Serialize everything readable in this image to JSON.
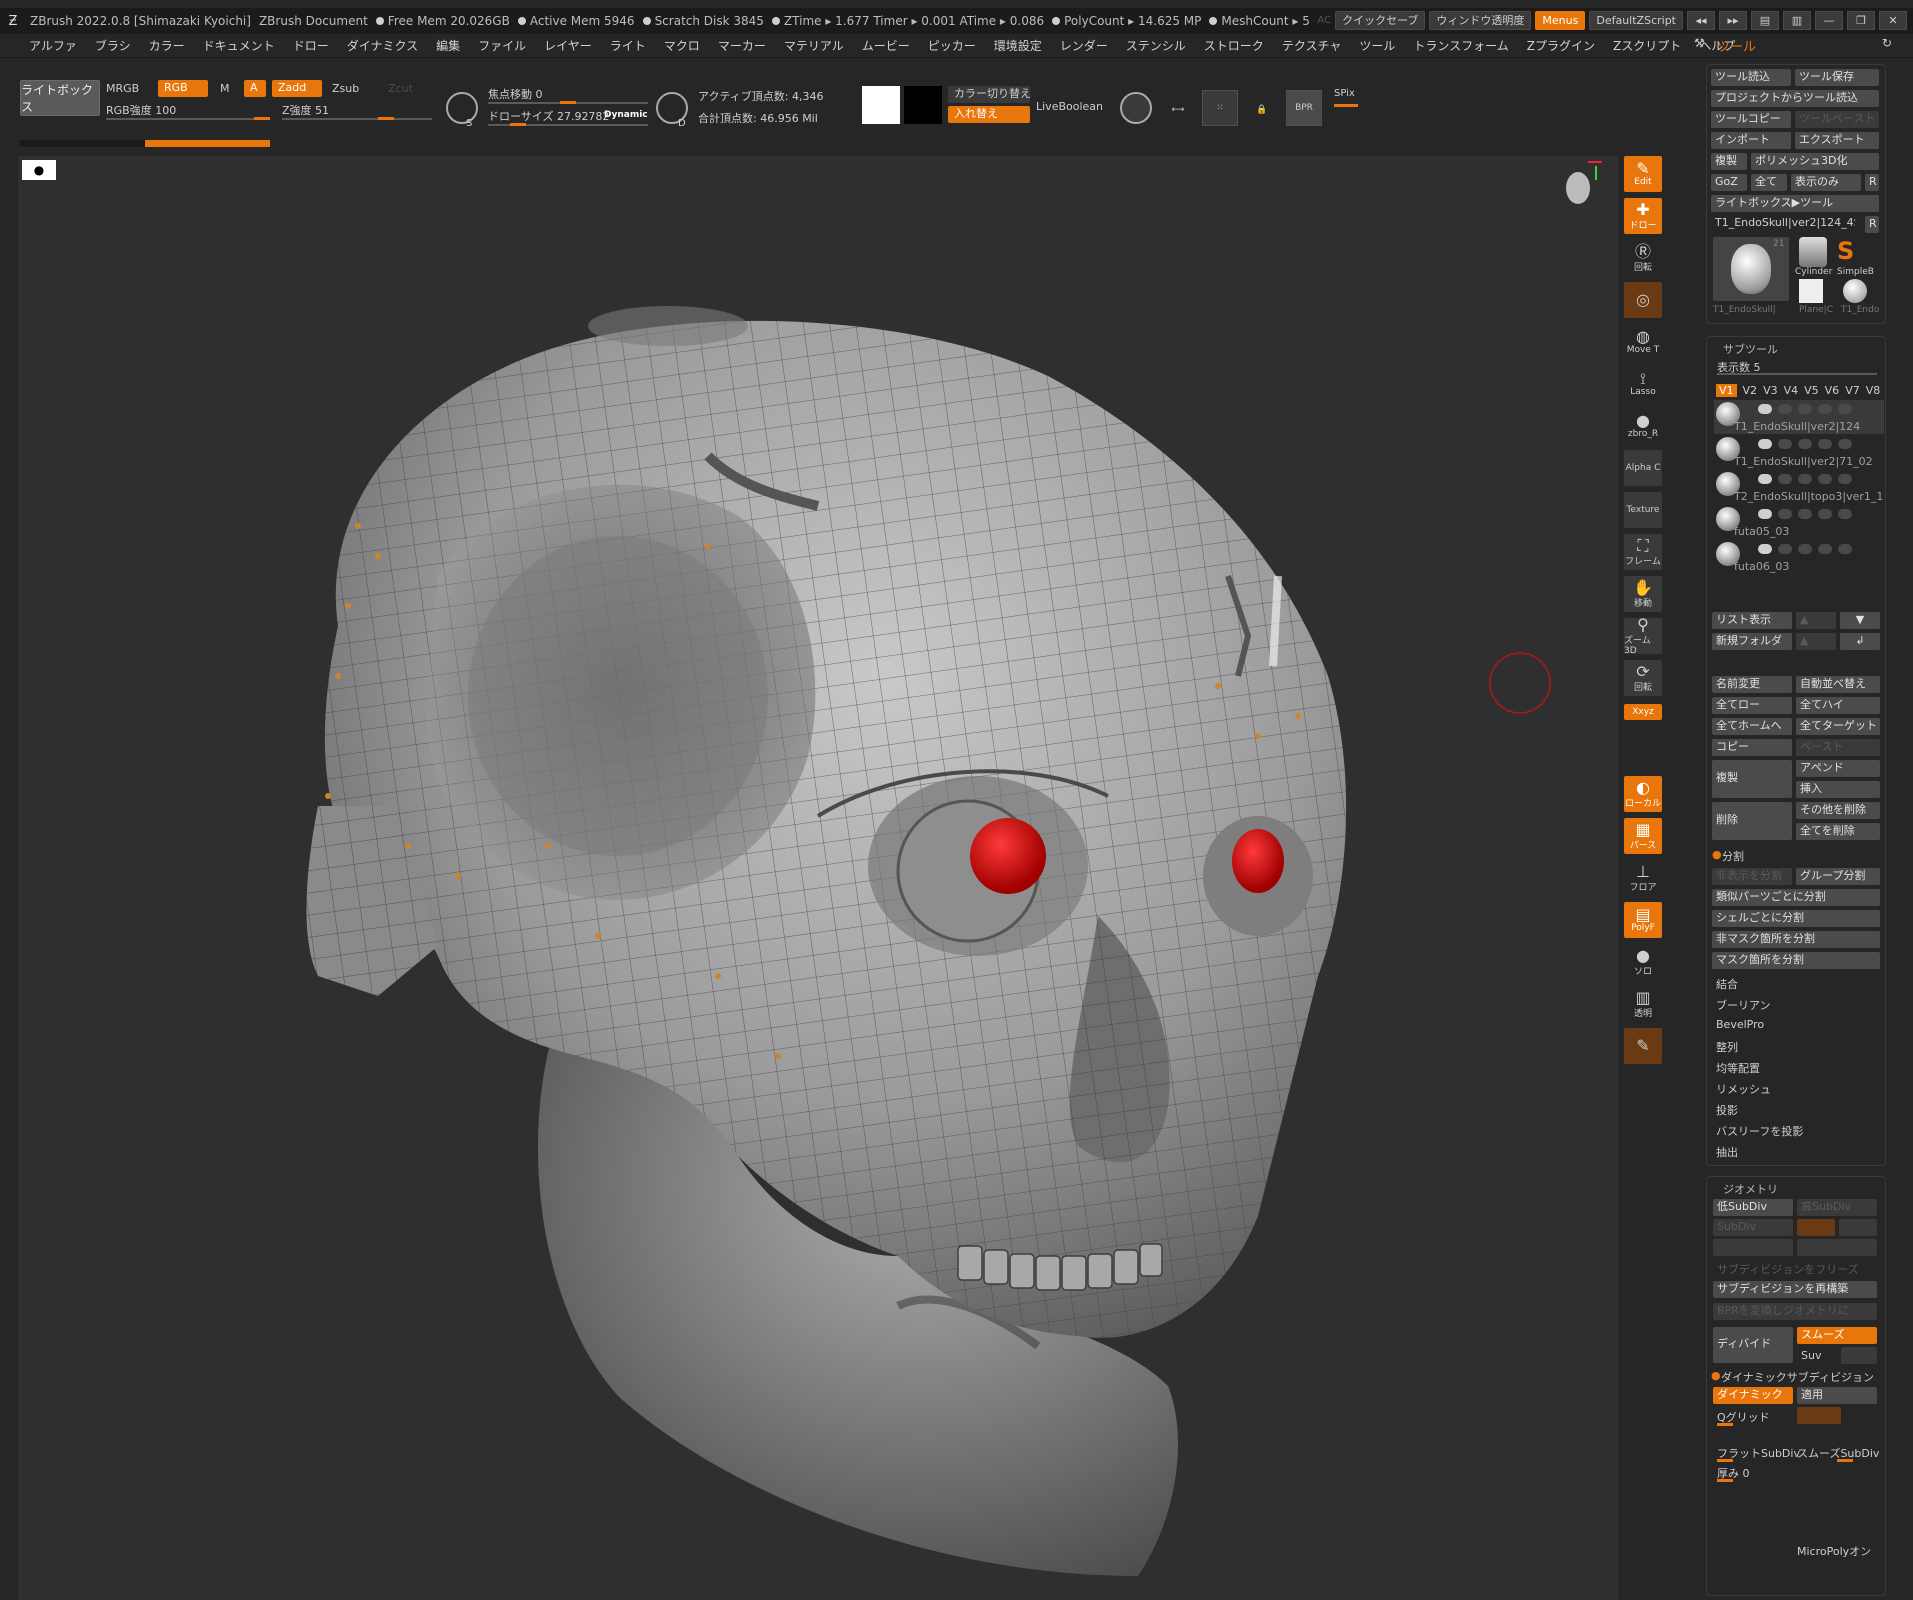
{
  "titlebar": {
    "app": "ZBrush 2022.0.8 [Shimazaki Kyoichi]",
    "doc": "ZBrush Document",
    "stats": [
      "Free Mem 20.026GB",
      "Active Mem 5946",
      "Scratch Disk 3845",
      "ZTime ▸ 1.677 Timer ▸ 0.001 ATime ▸ 0.086",
      "PolyCount ▸ 14.625 MP",
      "MeshCount ▸ 5"
    ],
    "right_ac": "AC",
    "quicksave": "クイックセーブ",
    "transparency": "ウィンドウ透明度",
    "menus": "Menus",
    "script": "DefaultZScript"
  },
  "menu": {
    "items": [
      "アルファ",
      "ブラシ",
      "カラー",
      "ドキュメント",
      "ドロー",
      "ダイナミクス",
      "編集",
      "ファイル",
      "レイヤー",
      "ライト",
      "マクロ",
      "マーカー",
      "マテリアル",
      "ムービー",
      "ピッカー",
      "環境設定",
      "レンダー",
      "ステンシル",
      "ストローク",
      "テクスチャ",
      "ツール",
      "トランスフォーム",
      "Zプラグイン",
      "Zスクリプト",
      "ヘルプ"
    ],
    "tool_label": "ツール"
  },
  "shelf": {
    "lightbox": "ライトボックス",
    "mrgb": "MRGB",
    "rgb": "RGB",
    "m": "M",
    "a": "A",
    "zadd": "Zadd",
    "zsub": "Zsub",
    "zcut": "Zcut",
    "rgb_intensity": "RGB強度 100",
    "z_intensity": "Z強度 51",
    "focal_shift": "焦点移動 0",
    "draw_size": "ドローサイズ 27.92782",
    "dynamic": "Dynamic",
    "active_points": "アクティブ頂点数: 4,346",
    "total_points": "合計頂点数: 46.956 Mil",
    "color_switch": "カラー切り替え",
    "swap": "入れ替え",
    "liveboolean": "LiveBoolean",
    "spix": "SPix",
    "bpr": "BPR",
    "s": "S",
    "d": "D"
  },
  "progress": {
    "value": 0.5
  },
  "rightstrip": {
    "edit": "Edit",
    "draw": "ドロー",
    "rotate": "回転",
    "move": "Move T",
    "lasso": "Lasso",
    "zbro": "zbro_R",
    "alpha": "Alpha C",
    "texture": "Texture",
    "frame": "フレーム",
    "pan": "移動",
    "zoom": "ズーム3D",
    "rot": "回転",
    "xyz": "Xxyz",
    "local": "ローカル",
    "persp": "パース",
    "floor": "フロア",
    "polyf": "PolyF",
    "solo": "ソロ",
    "transp": "透明"
  },
  "tool_panel": {
    "load": "ツール読込",
    "save": "ツール保存",
    "load_project": "プロジェクトからツール読込",
    "copy": "ツールコピー",
    "paste": "ツールペースト",
    "import": "インポート",
    "export": "エクスポート",
    "clone": "複製",
    "polymesh": "ポリメッシュ3D化",
    "goz": "GoZ",
    "all": "全て",
    "visible": "表示のみ",
    "r": "R",
    "lightbox_tool": "ライトボックス▶ツール",
    "current_tool": "T1_EndoSkull|ver2|124_4S",
    "count": "21",
    "thumbs": [
      "T1_EndoSkull|",
      "Cylinder",
      "SimpleB",
      "Plane|C",
      "T1_Endo"
    ]
  },
  "subtool": {
    "header": "サブツール",
    "visible_count": "表示数 5",
    "vtabs": [
      "V1",
      "V2",
      "V3",
      "V4",
      "V5",
      "V6",
      "V7",
      "V8"
    ],
    "items": [
      "T1_EndoSkull|ver2|124",
      "T1_EndoSkull|ver2|71_02",
      "T2_EndoSkull|topo3|ver1_1",
      "futa05_03",
      "futa06_03"
    ],
    "list_view": "リスト表示",
    "new_folder": "新規フォルダ",
    "rename": "名前変更",
    "autoreorder": "自動並べ替え",
    "all_low": "全てロー",
    "all_high": "全てハイ",
    "all_home": "全てホームへ",
    "all_target": "全てターゲット",
    "copy": "コピー",
    "paste": "ペースト",
    "duplicate": "複製",
    "append": "アペンド",
    "insert": "挿入",
    "delete": "削除",
    "delete_other": "その他を削除",
    "delete_all": "全てを削除",
    "split_header": "分割",
    "split_hidden": "非表示を分割",
    "group_split": "グループ分割",
    "similar": "類似パーツごとに分割",
    "shell": "シェルごとに分割",
    "unmasked": "非マスク箇所を分割",
    "masked": "マスク箇所を分割",
    "merge": "結合",
    "boolean": "ブーリアン",
    "bevelpro": "BevelPro",
    "align": "整列",
    "distribute": "均等配置",
    "remesh": "リメッシュ",
    "project": "投影",
    "project_bas": "バスリーフを投影",
    "extract": "抽出"
  },
  "geometry": {
    "header": "ジオメトリ",
    "lower": "低SubDiv",
    "higher": "高SubDiv",
    "subdiv": "SubDiv",
    "freeze": "サブディビジョンをフリーズ",
    "rebuild": "サブディビジョンを再構築",
    "convert": "BPRを変換しジオメトリに",
    "divide": "ディバイド",
    "smooth": "スムーズ",
    "suv": "Suv",
    "dynamic_header": "ダイナミックサブディビジョン",
    "dynamic": "ダイナミック",
    "apply": "適用",
    "qgrid": "Qグリッド",
    "flat_subdiv": "フラットSubDiv",
    "smooth_subdiv": "スムーズSubDiv",
    "thickness": "厚み 0",
    "micropoly": "MicroPolyオン"
  },
  "colors": {
    "accent": "#e8760a",
    "bg": "#262626",
    "canvas": "#2f2f2f",
    "eye": "#d40000"
  }
}
